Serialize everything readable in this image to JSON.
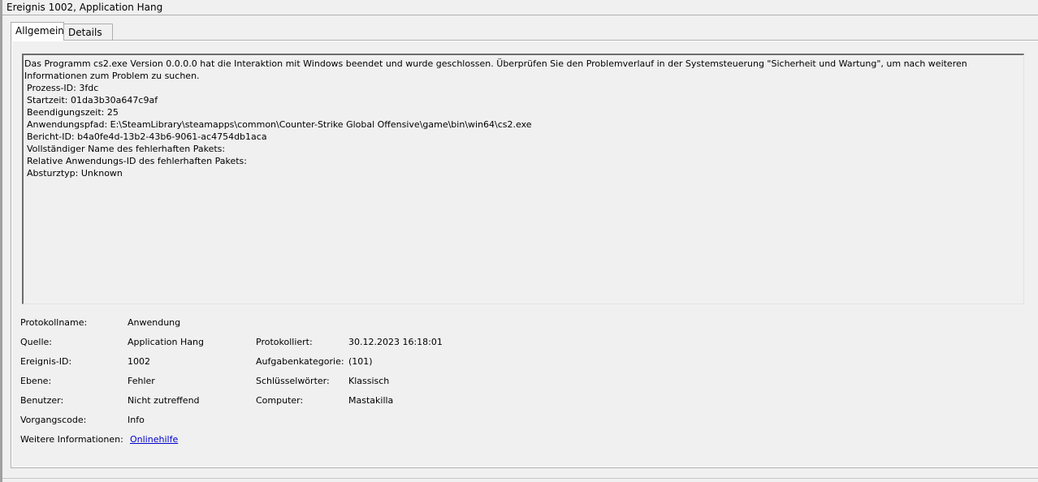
{
  "window": {
    "title": "Ereignis 1002, Application Hang"
  },
  "tabs": [
    {
      "label": "Allgemein",
      "active": true
    },
    {
      "label": "Details",
      "active": false
    }
  ],
  "description": {
    "intro": "Das Programm cs2.exe Version 0.0.0.0 hat die Interaktion mit Windows beendet und wurde geschlossen. Überprüfen Sie den Problemverlauf in der Systemsteuerung \"Sicherheit und Wartung\", um nach weiteren Informationen zum Problem zu suchen.",
    "lines": [
      "Prozess-ID: 3fdc",
      "Startzeit: 01da3b30a647c9af",
      "Beendigungszeit: 25",
      "Anwendungspfad: E:\\SteamLibrary\\steamapps\\common\\Counter-Strike Global Offensive\\game\\bin\\win64\\cs2.exe",
      "Bericht-ID: b4a0fe4d-13b2-43b6-9061-ac4754db1aca",
      "Vollständiger Name des fehlerhaften Pakets:",
      "Relative Anwendungs-ID des fehlerhaften Pakets:",
      "Absturztyp: Unknown"
    ]
  },
  "properties": {
    "protokollname": {
      "label": "Protokollname:",
      "value": "Anwendung"
    },
    "quelle": {
      "label": "Quelle:",
      "value": "Application Hang"
    },
    "protokolliert": {
      "label": "Protokolliert:",
      "value": "30.12.2023 16:18:01"
    },
    "ereignis_id": {
      "label": "Ereignis-ID:",
      "value": "1002"
    },
    "aufgabenkategorie": {
      "label": "Aufgabenkategorie:",
      "value": "(101)"
    },
    "ebene": {
      "label": "Ebene:",
      "value": "Fehler"
    },
    "schluesselwoerter": {
      "label": "Schlüsselwörter:",
      "value": "Klassisch"
    },
    "benutzer": {
      "label": "Benutzer:",
      "value": "Nicht zutreffend"
    },
    "computer": {
      "label": "Computer:",
      "value": "Mastakilla"
    },
    "vorgangscode": {
      "label": "Vorgangscode:",
      "value": "Info"
    },
    "weitere_informationen": {
      "label": "Weitere Informationen:",
      "link": "Onlinehilfe"
    }
  },
  "colors": {
    "link": "#0000cc",
    "background": "#f0f0f0"
  }
}
